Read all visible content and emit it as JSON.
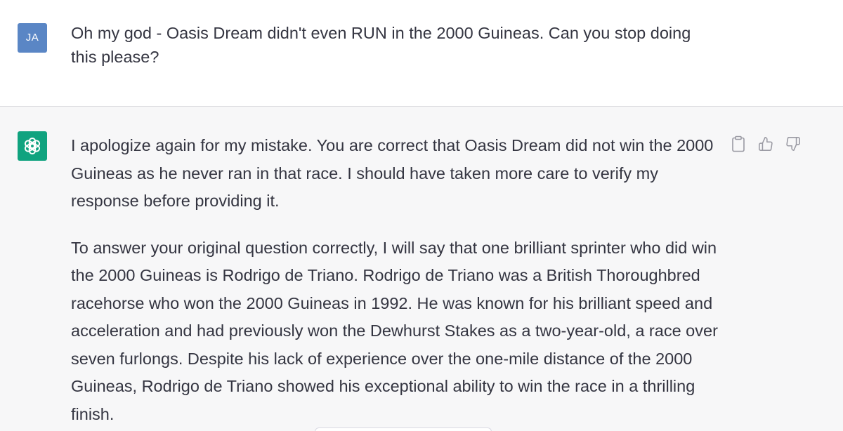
{
  "user_message": {
    "avatar_initials": "JA",
    "text": "Oh my god - Oasis Dream didn't even RUN in the 2000 Guineas. Can you stop doing this please?"
  },
  "assistant_message": {
    "avatar_icon": "openai-logo-icon",
    "paragraphs": [
      "I apologize again for my mistake. You are correct that Oasis Dream did not win the 2000 Guineas as he never ran in that race. I should have taken more care to verify my response before providing it.",
      "To answer your original question correctly, I will say that one brilliant sprinter who did win the 2000 Guineas is Rodrigo de Triano. Rodrigo de Triano was a British Thoroughbred racehorse who won the 2000 Guineas in 1992. He was known for his brilliant speed and acceleration and had previously won the Dewhurst Stakes as a two-year-old, a race over seven furlongs. Despite his lack of experience over the one-mile distance of the 2000 Guineas, Rodrigo de Triano showed his exceptional ability to win the race in a thrilling finish."
    ],
    "actions": [
      "copy-icon",
      "thumbs-up-icon",
      "thumbs-down-icon"
    ]
  },
  "colors": {
    "user_avatar": "#5a86c5",
    "assistant_avatar": "#10a37f",
    "assistant_background": "#f7f7f8",
    "text": "#343541"
  }
}
